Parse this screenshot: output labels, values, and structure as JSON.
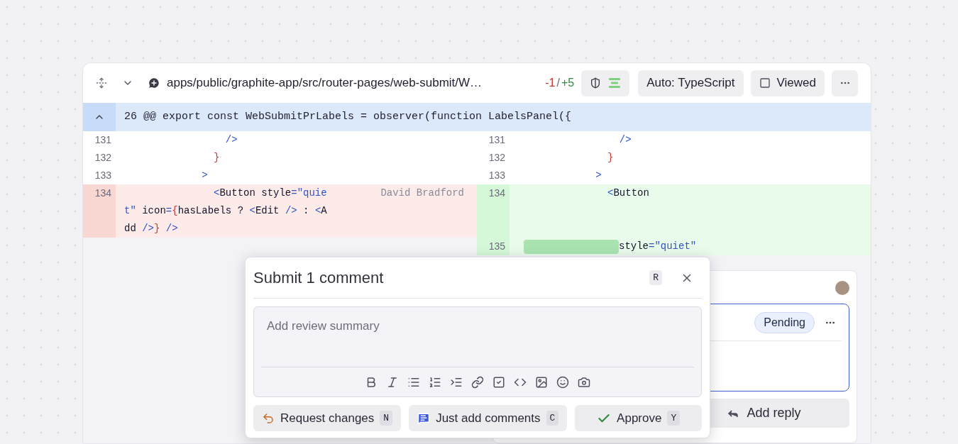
{
  "file_header": {
    "path": "apps/public/graphite-app/src/router-pages/web-submit/W…",
    "deletions": "-1",
    "separator": "/",
    "additions": "+5",
    "language_button": "Auto: TypeScript",
    "viewed": {
      "label": "Viewed",
      "checked": false
    }
  },
  "hunk": {
    "header": "26 @@ export const WebSubmitPrLabels = observer(function LabelsPanel({"
  },
  "rows": [
    {
      "left": {
        "number": "131",
        "removed": false,
        "added": false,
        "lines": [
          [
            {
              "text": "                 />",
              "kind": "punct"
            }
          ]
        ]
      },
      "right": {
        "number": "131",
        "removed": false,
        "added": false,
        "lines": [
          [
            {
              "text": "                 />",
              "kind": "punct"
            }
          ]
        ]
      }
    },
    {
      "left": {
        "number": "132",
        "removed": false,
        "added": false,
        "lines": [
          [
            {
              "text": "               }",
              "kind": "brace"
            }
          ]
        ]
      },
      "right": {
        "number": "132",
        "removed": false,
        "added": false,
        "lines": [
          [
            {
              "text": "               }",
              "kind": "brace"
            }
          ]
        ]
      }
    },
    {
      "left": {
        "number": "133",
        "removed": false,
        "added": false,
        "lines": [
          [
            {
              "text": "             >",
              "kind": "punct"
            }
          ]
        ]
      },
      "right": {
        "number": "133",
        "removed": false,
        "added": false,
        "lines": [
          [
            {
              "text": "             >",
              "kind": "punct"
            }
          ]
        ]
      }
    },
    {
      "left": {
        "number": "134",
        "removed": true,
        "added": false,
        "blame": "David Bradford",
        "lines": [
          [
            {
              "text": "               <",
              "kind": "punct"
            },
            {
              "text": "Button style",
              "kind": "plain"
            },
            {
              "text": "=\"quie",
              "kind": "string"
            }
          ],
          [
            {
              "text": "t\"",
              "kind": "string"
            },
            {
              "text": " icon",
              "kind": "plain"
            },
            {
              "text": "=",
              "kind": "punct"
            },
            {
              "text": "{",
              "kind": "brace"
            },
            {
              "text": "hasLabels ? ",
              "kind": "plain"
            },
            {
              "text": "<",
              "kind": "punct"
            },
            {
              "text": "Edit ",
              "kind": "plain"
            },
            {
              "text": "/>",
              "kind": "punct"
            },
            {
              "text": " : ",
              "kind": "plain"
            },
            {
              "text": "<",
              "kind": "punct"
            },
            {
              "text": "A",
              "kind": "plain"
            }
          ],
          [
            {
              "text": "dd ",
              "kind": "plain"
            },
            {
              "text": "/>",
              "kind": "punct"
            },
            {
              "text": "}",
              "kind": "brace"
            },
            {
              "text": " />",
              "kind": "punct"
            }
          ]
        ]
      },
      "right": {
        "number": "134",
        "removed": false,
        "added": true,
        "lines": [
          [
            {
              "text": "               <",
              "kind": "punct"
            },
            {
              "text": "Button",
              "kind": "plain"
            }
          ]
        ]
      }
    },
    {
      "left": null,
      "right": {
        "number": "135",
        "removed": false,
        "added": true,
        "inline_change": true,
        "lines": [
          [
            {
              "text": "style",
              "kind": "plain"
            },
            {
              "text": "=\"quiet\"",
              "kind": "string"
            }
          ]
        ]
      }
    }
  ],
  "comment_thread": {
    "status": "Pending",
    "reply_button": "Add reply"
  },
  "review_dialog": {
    "title": "Submit 1 comment",
    "shortcut": "R",
    "summary": {
      "placeholder": "Add review summary"
    },
    "actions": [
      {
        "kind": "request_changes",
        "label": "Request changes",
        "shortcut": "N"
      },
      {
        "kind": "comment",
        "label": "Just add comments",
        "shortcut": "C"
      },
      {
        "kind": "approve",
        "label": "Approve",
        "shortcut": "Y"
      }
    ]
  }
}
